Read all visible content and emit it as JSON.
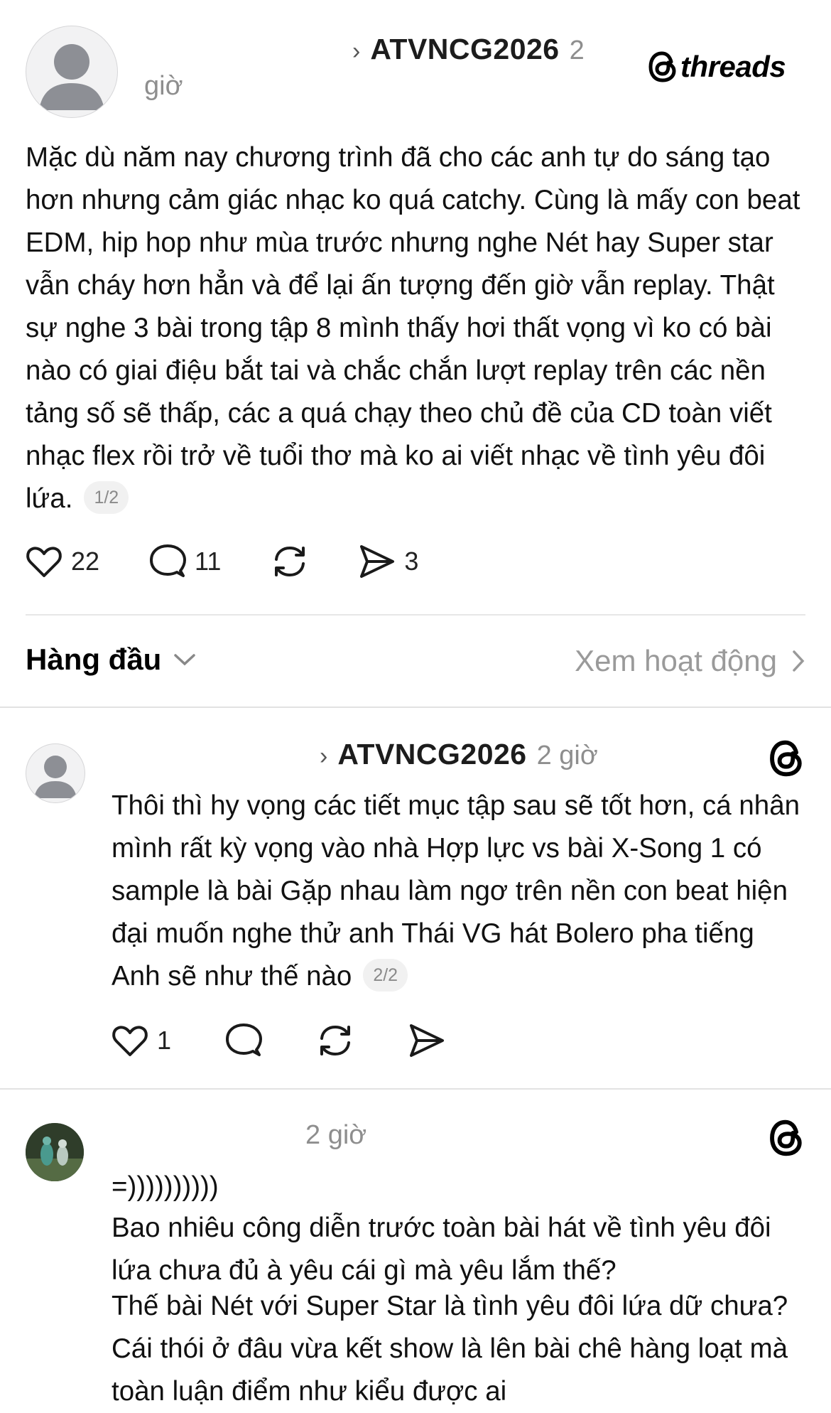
{
  "post": {
    "tag": "ATVNCG2026",
    "time_number": "2",
    "time_unit": "giờ",
    "brand": "threads",
    "text": "Mặc dù năm nay chương trình đã cho các anh tự do sáng tạo hơn nhưng cảm giác nhạc ko quá catchy. Cùng là mấy con beat EDM, hip hop như mùa trước nhưng nghe Nét hay Super star vẫn cháy hơn hẳn và để lại ấn tượng đến giờ vẫn replay. Thật sự nghe 3 bài trong tập 8 mình thấy hơi thất vọng vì ko có bài nào có giai điệu bắt tai và chắc chắn lượt replay trên các nền tảng số sẽ thấp, các a quá chạy theo chủ đề của CD toàn viết nhạc flex rồi trở về tuổi thơ mà ko ai viết nhạc về tình yêu đôi lứa.",
    "page": "1/2",
    "likes": "22",
    "comments": "11",
    "shares": "3"
  },
  "filter": {
    "sort_label": "Hàng đầu",
    "activity_link": "Xem hoạt động"
  },
  "reply1": {
    "tag": "ATVNCG2026",
    "time": "2 giờ",
    "text": "Thôi thì hy vọng các tiết mục tập sau sẽ tốt hơn, cá nhân mình rất kỳ vọng vào nhà Hợp lực vs bài X-Song 1 có sample là bài Gặp nhau làm ngơ trên nền con beat hiện đại muốn nghe thử anh Thái VG hát Bolero pha tiếng Anh sẽ như thế nào",
    "page": "2/2",
    "likes": "1"
  },
  "reply2": {
    "time": "2 giờ",
    "text_line1": "=))))))))))",
    "text_para1": "Bao nhiêu công diễn trước toàn bài hát về tình yêu đôi lứa chưa đủ à yêu cái gì mà yêu lắm thế?",
    "text_para2": "Thế bài Nét với Super Star là tình yêu đôi lứa dữ chưa? Cái thói ở đâu vừa kết show là lên bài chê hàng loạt mà toàn luận điểm như kiểu được ai"
  },
  "icons": [
    "threads-logo-icon",
    "heart-icon",
    "comment-icon",
    "repost-icon",
    "send-icon",
    "chevron-down-icon",
    "chevron-right-icon"
  ]
}
